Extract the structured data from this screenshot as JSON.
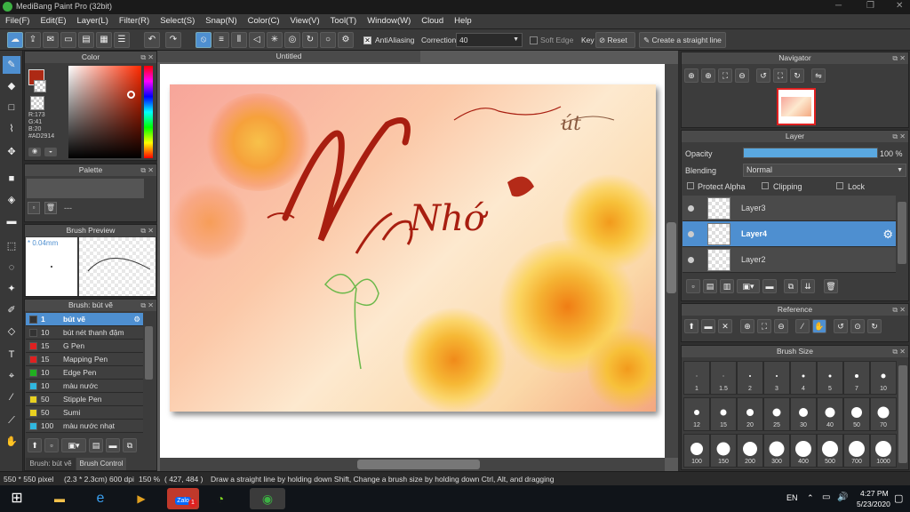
{
  "window": {
    "title": "MediBang Paint Pro (32bit)"
  },
  "menu": [
    "File(F)",
    "Edit(E)",
    "Layer(L)",
    "Filter(R)",
    "Select(S)",
    "Snap(N)",
    "Color(C)",
    "View(V)",
    "Tool(T)",
    "Window(W)",
    "Cloud",
    "Help"
  ],
  "toolbar": {
    "antialiasing_label": "AntiAliasing",
    "correction_label": "Correction",
    "correction_value": "40",
    "soft_edge_label": "Soft Edge",
    "key_label": "Key",
    "reset_label": "Reset",
    "straight_line_label": "Create a straight line"
  },
  "color_panel": {
    "title": "Color",
    "r": "R:173",
    "g": "G:41",
    "b": "B:20",
    "hex": "#AD2914",
    "fg_color": "#AD2914"
  },
  "palette_panel": {
    "title": "Palette",
    "dash": "---"
  },
  "brush_preview": {
    "title": "Brush Preview",
    "size": "0.04mm"
  },
  "brush_panel": {
    "title": "Brush: bút vẽ",
    "items": [
      {
        "size": "1",
        "name": "bút vẽ",
        "color": "#333333",
        "selected": true
      },
      {
        "size": "10",
        "name": "bút nét thanh đậm",
        "color": "#333333"
      },
      {
        "size": "15",
        "name": "G Pen",
        "color": "#e02020"
      },
      {
        "size": "15",
        "name": "Mapping Pen",
        "color": "#e02020"
      },
      {
        "size": "10",
        "name": "Edge Pen",
        "color": "#20b020"
      },
      {
        "size": "10",
        "name": "màu nước",
        "color": "#30b8e0"
      },
      {
        "size": "50",
        "name": "Stipple Pen",
        "color": "#e8d020"
      },
      {
        "size": "50",
        "name": "Sumi",
        "color": "#e8d020"
      },
      {
        "size": "100",
        "name": "màu nước nhạt",
        "color": "#30b8e0"
      }
    ],
    "tab_brush": "Brush: bút vẽ",
    "tab_control": "Brush Control"
  },
  "document": {
    "tab": "Untitled",
    "artwork_text": "Nhớ",
    "artwork_text2": "út"
  },
  "navigator": {
    "title": "Navigator"
  },
  "layer_panel": {
    "title": "Layer",
    "opacity_label": "Opacity",
    "opacity_value": "100 %",
    "opacity": 1.0,
    "blending_label": "Blending",
    "blending_value": "Normal",
    "protect_alpha": "Protect Alpha",
    "clipping": "Clipping",
    "lock": "Lock",
    "layers": [
      {
        "name": "Layer3"
      },
      {
        "name": "Layer4",
        "selected": true
      },
      {
        "name": "Layer2"
      }
    ]
  },
  "reference": {
    "title": "Reference"
  },
  "brush_size": {
    "title": "Brush Size",
    "sizes": [
      "1",
      "1.5",
      "2",
      "3",
      "4",
      "5",
      "7",
      "10",
      "12",
      "15",
      "20",
      "25",
      "30",
      "40",
      "50",
      "70",
      "100",
      "150",
      "200",
      "300",
      "400",
      "500",
      "700",
      "1000"
    ]
  },
  "status": {
    "size": "550 * 550 pixel",
    "cm": "(2.3 * 2.3cm)",
    "dpi": "600 dpi",
    "zoom": "150 %",
    "coords": "( 427, 484 )",
    "hint": "Draw a straight line by holding down Shift, Change a brush size by holding down Ctrl, Alt, and dragging"
  },
  "taskbar": {
    "lang": "EN",
    "time": "4:27 PM",
    "date": "5/23/2020",
    "zalo_label": "Zalo",
    "zalo_badge": "1"
  }
}
